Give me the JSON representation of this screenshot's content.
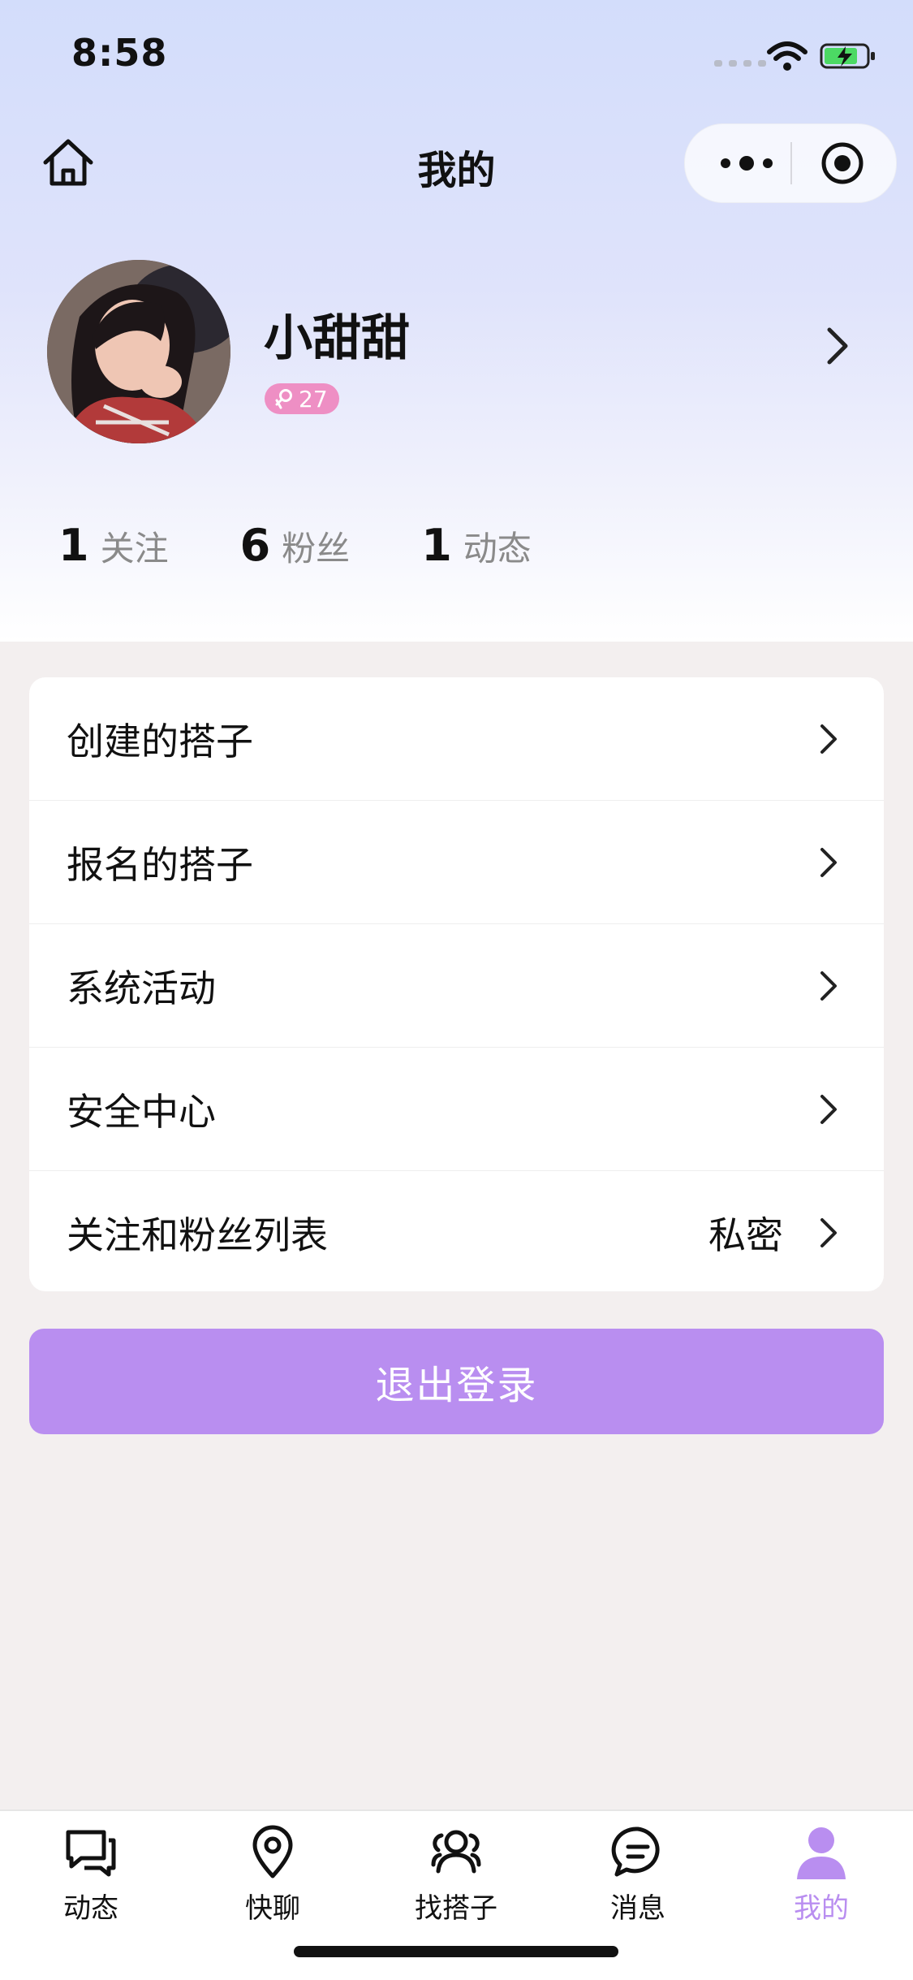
{
  "status_bar": {
    "time": "8:58"
  },
  "nav": {
    "title": "我的"
  },
  "profile": {
    "nickname": "小甜甜",
    "age": "27",
    "gender_icon": "female-icon"
  },
  "stats": [
    {
      "count": "1",
      "label": "关注"
    },
    {
      "count": "6",
      "label": "粉丝"
    },
    {
      "count": "1",
      "label": "动态"
    }
  ],
  "menu": [
    {
      "label": "创建的搭子",
      "value": ""
    },
    {
      "label": "报名的搭子",
      "value": ""
    },
    {
      "label": "系统活动",
      "value": ""
    },
    {
      "label": "安全中心",
      "value": ""
    },
    {
      "label": "关注和粉丝列表",
      "value": "私密"
    }
  ],
  "logout": {
    "label": "退出登录"
  },
  "tabbar": [
    {
      "label": "动态",
      "icon": "chat-bubbles-icon"
    },
    {
      "label": "快聊",
      "icon": "location-pin-icon"
    },
    {
      "label": "找搭子",
      "icon": "people-icon"
    },
    {
      "label": "消息",
      "icon": "message-icon"
    },
    {
      "label": "我的",
      "icon": "person-icon",
      "active": true
    }
  ],
  "colors": {
    "accent": "#b98ef0",
    "badge": "#ee8fc4",
    "page_bg": "#f3efef"
  }
}
